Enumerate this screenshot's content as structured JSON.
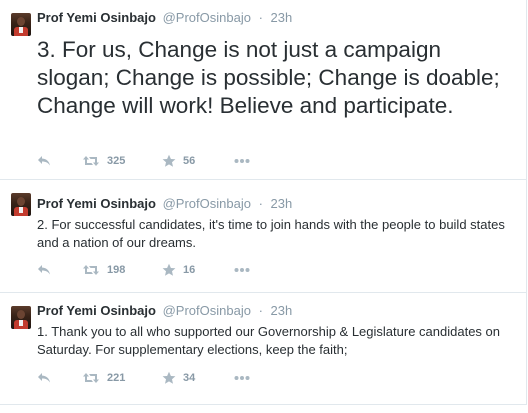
{
  "timeline": {
    "tweets": [
      {
        "fullname": "Prof Yemi Osinbajo",
        "handle": "@ProfOsinbajo",
        "separator": "·",
        "time": "23h",
        "text": "3. For us, Change is not just a campaign slogan; Change is possible; Change is doable; Change will work! Believe and participate.",
        "retweets": "325",
        "favorites": "56"
      },
      {
        "fullname": "Prof Yemi Osinbajo",
        "handle": "@ProfOsinbajo",
        "separator": "·",
        "time": "23h",
        "text": "2. For successful candidates, it's time to join hands with the people to build states and a nation of our dreams.",
        "retweets": "198",
        "favorites": "16"
      },
      {
        "fullname": "Prof Yemi Osinbajo",
        "handle": "@ProfOsinbajo",
        "separator": "·",
        "time": "23h",
        "text": "1. Thank you to all who supported our Governorship & Legislature candidates on Saturday. For supplementary elections, keep the faith;",
        "retweets": "221",
        "favorites": "34"
      }
    ]
  },
  "icons": {
    "reply": "reply-icon",
    "retweet": "retweet-icon",
    "favorite": "star-icon",
    "more": "more-icon"
  },
  "colors": {
    "text": "#292f33",
    "muted": "#8899a6",
    "border": "#e1e8ed"
  }
}
